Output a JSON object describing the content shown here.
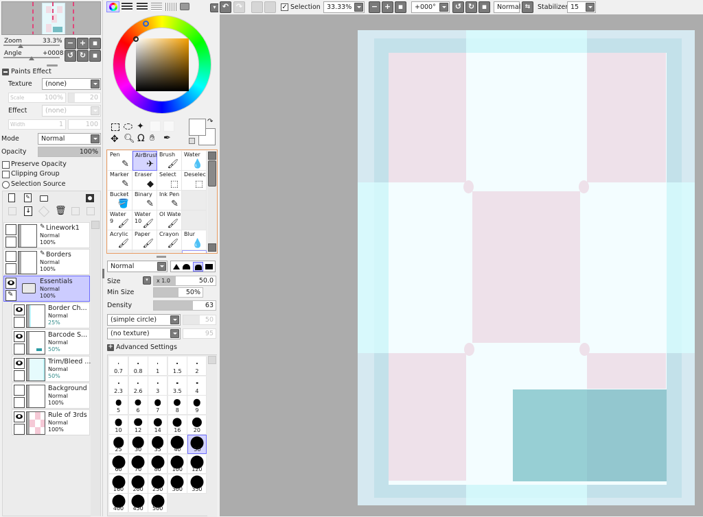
{
  "navigator": {
    "zoom_label": "Zoom",
    "zoom_value": "33.3%",
    "angle_label": "Angle",
    "angle_value": "+0008",
    "zoom_slider_fraction": 0.2,
    "angle_slider_fraction": 0.5
  },
  "paints_effect": {
    "header": "Paints Effect",
    "texture_label": "Texture",
    "texture_value": "(none)",
    "scale_label": "Scale",
    "scale_value": "100%",
    "scale_strength": "20",
    "effect_label": "Effect",
    "effect_value": "(none)",
    "width_label": "Width",
    "width_value": "1",
    "width_strength": "100"
  },
  "layer_props": {
    "mode_label": "Mode",
    "mode_value": "Normal",
    "opacity_label": "Opacity",
    "opacity_value": "100%",
    "opacity_fraction": 1.0,
    "preserve_opacity": "Preserve Opacity",
    "clipping_group": "Clipping Group",
    "selection_source": "Selection Source"
  },
  "layers": [
    {
      "name": "Linework1",
      "mode": "Normal",
      "opacity": "100%",
      "type": "pen",
      "visible": false,
      "selected": false,
      "sub": false
    },
    {
      "name": "Borders",
      "mode": "Normal",
      "opacity": "100%",
      "type": "pen",
      "visible": false,
      "selected": false,
      "sub": false
    },
    {
      "name": "Essentials",
      "mode": "Normal",
      "opacity": "100%",
      "type": "folder",
      "visible": true,
      "selected": true,
      "sub": false
    },
    {
      "name": "Border Ch...",
      "mode": "Normal",
      "opacity": "25%",
      "type": "raster",
      "visible": true,
      "selected": false,
      "sub": true
    },
    {
      "name": "Barcode S...",
      "mode": "Normal",
      "opacity": "50%",
      "type": "raster",
      "visible": true,
      "selected": false,
      "sub": true
    },
    {
      "name": "Trim/Bleed ...",
      "mode": "Normal",
      "opacity": "50%",
      "type": "raster",
      "visible": true,
      "selected": false,
      "sub": true
    },
    {
      "name": "Background",
      "mode": "Normal",
      "opacity": "100%",
      "type": "raster",
      "visible": false,
      "selected": false,
      "sub": true
    },
    {
      "name": "Rule of 3rds",
      "mode": "Normal",
      "opacity": "100%",
      "type": "raster",
      "visible": true,
      "selected": false,
      "sub": true
    }
  ],
  "color_tabs": [
    "color-wheel",
    "rgb-sliders",
    "hsv-sliders",
    "color-swatches",
    "user-swatches",
    "scratchpad"
  ],
  "selection_tools": [
    "rect-select",
    "lasso",
    "magic-wand",
    "move",
    "zoom",
    "rotate",
    "hand",
    "eyedropper"
  ],
  "tools": [
    {
      "label": "Pen",
      "icon": "✎"
    },
    {
      "label": "AirBrush",
      "icon": "✈",
      "selected": true
    },
    {
      "label": "Brush",
      "icon": "🖌"
    },
    {
      "label": "Water",
      "icon": "💧"
    },
    {
      "label": "Marker",
      "icon": "✎"
    },
    {
      "label": "Eraser",
      "icon": "◆"
    },
    {
      "label": "Select",
      "icon": "⬚"
    },
    {
      "label": "Deselect",
      "icon": "⬚"
    },
    {
      "label": "Bucket",
      "icon": "🪣"
    },
    {
      "label": "Binary",
      "icon": "✎"
    },
    {
      "label": "Ink Pen",
      "icon": "✎"
    },
    {
      "label": "",
      "icon": "",
      "empty": true
    },
    {
      "label": "Water\n9",
      "icon": "🖌"
    },
    {
      "label": "Water\n10",
      "icon": "🖌"
    },
    {
      "label": "Ol Wate",
      "icon": "🖌"
    },
    {
      "label": "",
      "icon": "",
      "empty": true
    },
    {
      "label": "Acrylic",
      "icon": "🖌"
    },
    {
      "label": "Paper",
      "icon": "🖌"
    },
    {
      "label": "Crayon",
      "icon": "🖌"
    },
    {
      "label": "Blur",
      "icon": "💧"
    }
  ],
  "brush": {
    "blend_mode": "Normal",
    "size_label": "Size",
    "size_multiplier": "x 1.0",
    "size_value": "50.0",
    "min_size_label": "Min Size",
    "min_size_value": "50%",
    "density_label": "Density",
    "density_value": "63",
    "shape_value": "(simple circle)",
    "shape_strength": "50",
    "texture_value": "(no texture)",
    "texture_strength": "95",
    "advanced_settings": "Advanced Settings",
    "size_fraction": 0.35,
    "min_size_fraction": 0.5,
    "density_fraction": 0.63
  },
  "brush_sizes": [
    "0.7",
    "0.8",
    "1",
    "1.5",
    "2",
    "2.3",
    "2.6",
    "3",
    "3.5",
    "4",
    "5",
    "6",
    "7",
    "8",
    "9",
    "10",
    "12",
    "14",
    "16",
    "20",
    "25",
    "30",
    "35",
    "40",
    "50",
    "60",
    "70",
    "80",
    "100",
    "120",
    "160",
    "200",
    "250",
    "300",
    "350",
    "400",
    "450",
    "500"
  ],
  "brush_size_selected": "50",
  "toolbar": {
    "selection_label": "Selection",
    "selection_checked": true,
    "zoom_value": "33.33%",
    "angle_value": "+000°",
    "blend_value": "Normal",
    "stabilizer_label": "Stabilizer",
    "stabilizer_value": "15"
  },
  "canvas_colors": {
    "bleed": "#d6e9f1",
    "trim": "#c3e1ea",
    "cyan": "#d8fdff",
    "pink": "#eee1ea",
    "white": "#f3fdff",
    "barcode": "#97cfd4"
  }
}
